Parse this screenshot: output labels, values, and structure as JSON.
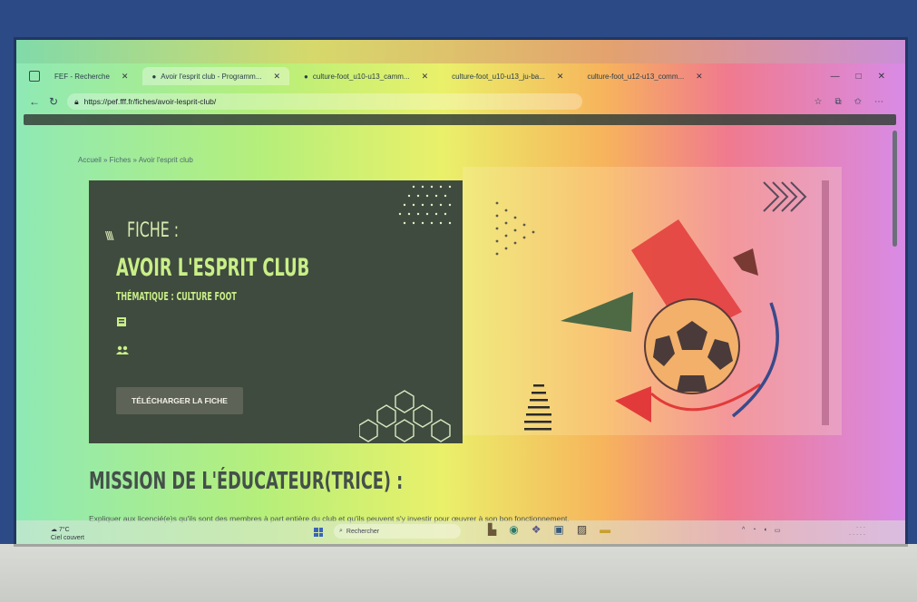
{
  "browser": {
    "tabs": [
      {
        "label": "FEF - Recherche"
      },
      {
        "label": "Avoir l'esprit club - Programm..."
      },
      {
        "label": "culture-foot_u10-u13_camm..."
      },
      {
        "label": "culture-foot_u10-u13_ju-ba..."
      },
      {
        "label": "culture-foot_u12-u13_comm..."
      }
    ],
    "url": "https://pef.fff.fr/fiches/avoir-lesprit-club/"
  },
  "page": {
    "breadcrumb": "Accueil » Fiches » Avoir l'esprit club",
    "hero": {
      "fiche_label": "FICHE :",
      "title": "AVOIR L'ESPRIT CLUB",
      "thematique": "THÉMATIQUE : CULTURE FOOT",
      "download_button": "TÉLÉCHARGER LA FICHE"
    },
    "mission_heading": "MISSION DE L'ÉDUCATEUR(TRICE) :",
    "mission_text": "Expliquer aux licencié(e)s qu'ils sont des membres à part entière du club et qu'ils peuvent s'y investir pour œuvrer à son bon fonctionnement."
  },
  "taskbar": {
    "weather_temp": "7°C",
    "weather_text": "Ciel couvert",
    "search_placeholder": "Rechercher"
  },
  "colors": {
    "hero_bg": "#3f4b3e",
    "accent_green": "#c9ef88",
    "ball_red": "#e23a3a"
  }
}
